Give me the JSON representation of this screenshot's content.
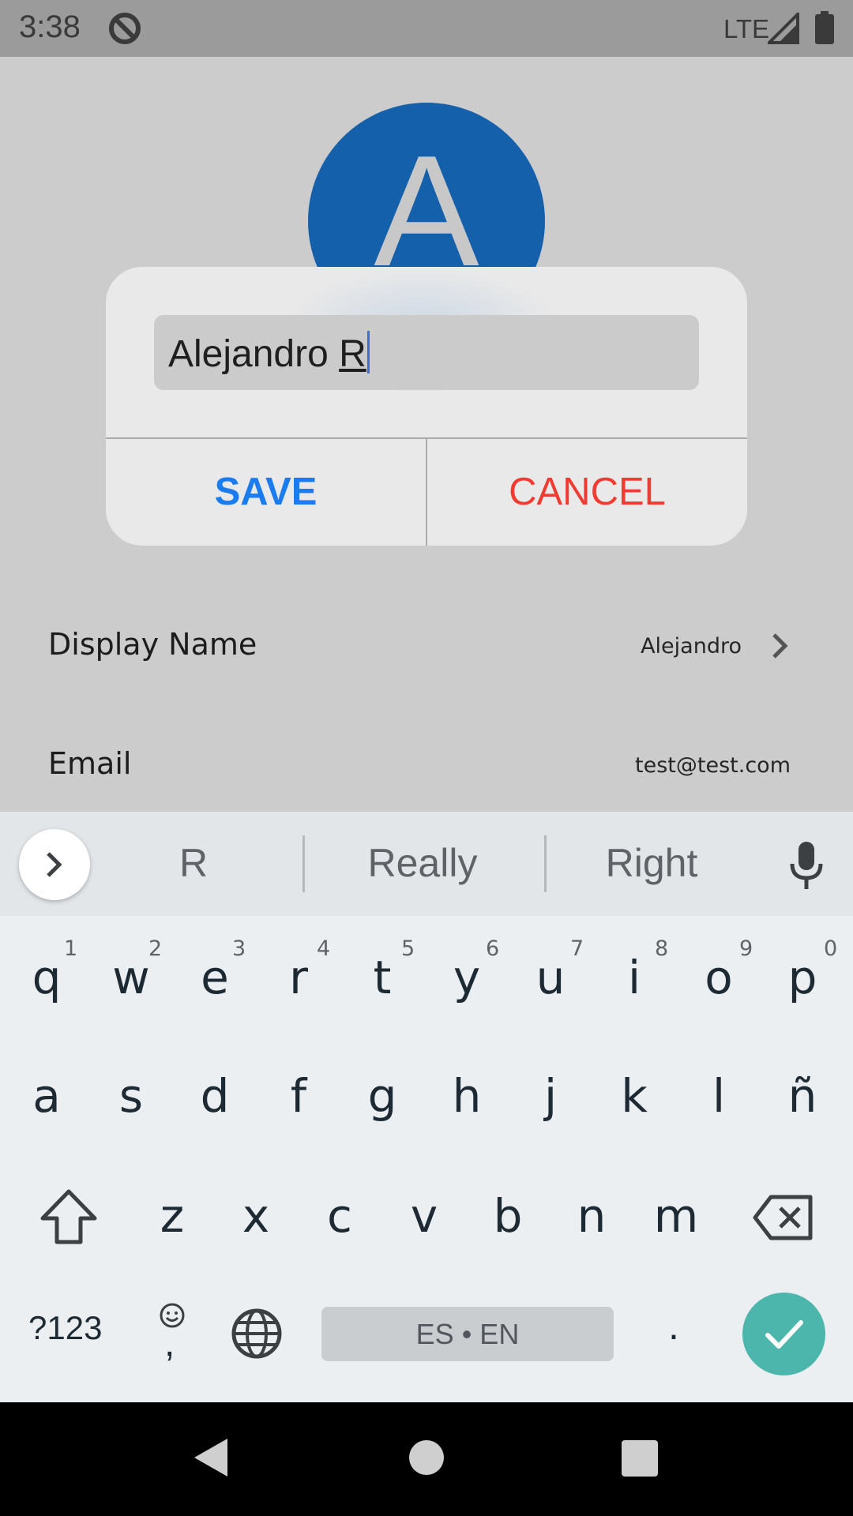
{
  "status_bar": {
    "time": "3:38",
    "network": "LTE"
  },
  "profile": {
    "avatar_letter": "A",
    "rows": [
      {
        "label": "Display Name",
        "value": "Alejandro"
      },
      {
        "label": "Email",
        "value": "test@test.com"
      }
    ]
  },
  "dialog": {
    "input_value_prefix": "Alejandro ",
    "input_value_composing": "R",
    "save_label": "SAVE",
    "cancel_label": "CANCEL",
    "colors": {
      "save": "#1b7cef",
      "cancel": "#f03b32"
    }
  },
  "keyboard": {
    "suggestions": [
      "R",
      "Really",
      "Right"
    ],
    "row1": [
      "q",
      "w",
      "e",
      "r",
      "t",
      "y",
      "u",
      "i",
      "o",
      "p"
    ],
    "row1_hints": [
      "1",
      "2",
      "3",
      "4",
      "5",
      "6",
      "7",
      "8",
      "9",
      "0"
    ],
    "row2": [
      "a",
      "s",
      "d",
      "f",
      "g",
      "h",
      "j",
      "k",
      "l",
      "ñ"
    ],
    "row3": [
      "z",
      "x",
      "c",
      "v",
      "b",
      "n",
      "m"
    ],
    "symbols_label": "?123",
    "space_label": "ES • EN",
    "period_label": ".",
    "emoji_comma_label": ",",
    "accent_color": "#4db6ac"
  }
}
